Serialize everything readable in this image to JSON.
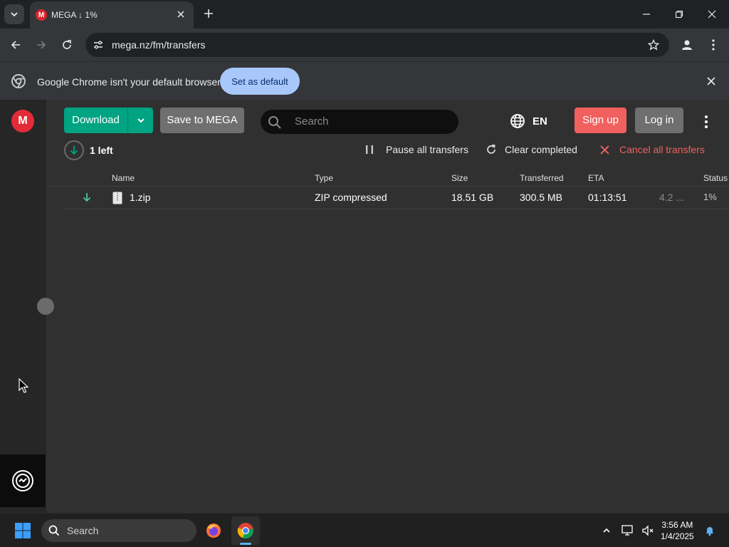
{
  "browser": {
    "tab_title": "MEGA ↓ 1%",
    "favicon_letter": "M",
    "url": "mega.nz/fm/transfers",
    "infobar": {
      "message": "Google Chrome isn't your default browser",
      "button_label": "Set as default"
    }
  },
  "mega": {
    "logo_letter": "M",
    "toolbar": {
      "download_label": "Download",
      "save_label": "Save to MEGA",
      "search_placeholder": "Search",
      "language": "EN",
      "signup_label": "Sign up",
      "login_label": "Log in"
    },
    "transfers": {
      "left_count": "1 left",
      "pause_all": "Pause all transfers",
      "clear_completed": "Clear completed",
      "cancel_all": "Cancel all transfers",
      "columns": [
        "Name",
        "Type",
        "Size",
        "Transferred",
        "ETA",
        "Status"
      ],
      "rows": [
        {
          "name": "1.zip",
          "type": "ZIP compressed",
          "size": "18.51 GB",
          "transferred": "300.5 MB",
          "eta": "01:13:51",
          "speed": "4.2 ...",
          "status": "1%"
        }
      ]
    }
  },
  "taskbar": {
    "search_placeholder": "Search",
    "time": "3:56 AM",
    "date": "1/4/2025"
  },
  "colors": {
    "mega_red": "#e32c38",
    "download_green": "#00a382",
    "signup_red": "#f0605e",
    "cancel_red": "#f0605e",
    "chrome_blue_button": "#a8c7fa"
  }
}
